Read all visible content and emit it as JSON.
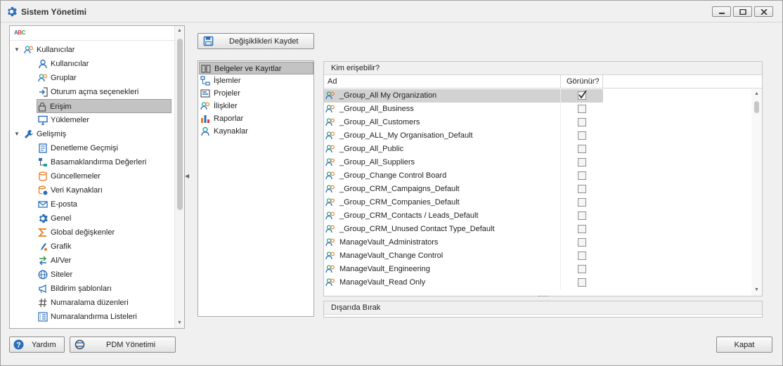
{
  "window": {
    "title": "Sistem Yönetimi"
  },
  "tree": {
    "items": [
      {
        "label": "Kullanıcılar",
        "level": 0,
        "icon": "users-icon",
        "expanded": true
      },
      {
        "label": "Kullanıcılar",
        "level": 1,
        "icon": "user-icon"
      },
      {
        "label": "Gruplar",
        "level": 1,
        "icon": "group-icon"
      },
      {
        "label": "Oturum açma seçenekleri",
        "level": 1,
        "icon": "login-options-icon"
      },
      {
        "label": "Erişim",
        "level": 1,
        "icon": "lock-icon",
        "selected": true
      },
      {
        "label": "Yüklemeler",
        "level": 1,
        "icon": "monitor-icon"
      },
      {
        "label": "Gelişmiş",
        "level": 0,
        "icon": "wrench-icon",
        "expanded": true
      },
      {
        "label": "Denetleme Geçmişi",
        "level": 1,
        "icon": "audit-icon"
      },
      {
        "label": "Basamaklandırma Değerleri",
        "level": 1,
        "icon": "cascade-icon"
      },
      {
        "label": "Güncellemeler",
        "level": 1,
        "icon": "database-icon"
      },
      {
        "label": "Veri Kaynakları",
        "level": 1,
        "icon": "datasource-icon"
      },
      {
        "label": "E-posta",
        "level": 1,
        "icon": "email-icon"
      },
      {
        "label": "Genel",
        "level": 1,
        "icon": "gear-icon"
      },
      {
        "label": "Global değişkenler",
        "level": 1,
        "icon": "sigma-icon"
      },
      {
        "label": "Grafik",
        "level": 1,
        "icon": "paint-icon"
      },
      {
        "label": "Al/Ver",
        "level": 1,
        "icon": "transfer-icon"
      },
      {
        "label": "Siteler",
        "level": 1,
        "icon": "globe-icon"
      },
      {
        "label": "Bildirim şablonları",
        "level": 1,
        "icon": "megaphone-icon"
      },
      {
        "label": "Numaralama düzenleri",
        "level": 1,
        "icon": "hash-icon"
      },
      {
        "label": "Numaralandırma Listeleri",
        "level": 1,
        "icon": "list-icon"
      }
    ]
  },
  "toolbar": {
    "save_label": "Değişiklikleri Kaydet"
  },
  "categories": [
    {
      "label": "Belgeler ve Kayıtlar",
      "icon": "documents-icon",
      "selected": true
    },
    {
      "label": "İşlemler",
      "icon": "process-icon"
    },
    {
      "label": "Projeler",
      "icon": "projects-icon"
    },
    {
      "label": "İlişkiler",
      "icon": "relations-icon"
    },
    {
      "label": "Raporlar",
      "icon": "chart-icon"
    },
    {
      "label": "Kaynaklar",
      "icon": "resources-icon"
    }
  ],
  "access_grid": {
    "caption": "Kim erişebilir?",
    "col_name": "Ad",
    "col_visible": "Görünür?",
    "rows": [
      {
        "name": "_Group_All My Organization",
        "visible": true,
        "active": true
      },
      {
        "name": "_Group_All_Business",
        "visible": false
      },
      {
        "name": "_Group_All_Customers",
        "visible": false
      },
      {
        "name": "_Group_ALL_My Organisation_Default",
        "visible": false
      },
      {
        "name": "_Group_All_Public",
        "visible": false
      },
      {
        "name": "_Group_All_Suppliers",
        "visible": false
      },
      {
        "name": "_Group_Change Control Board",
        "visible": false
      },
      {
        "name": "_Group_CRM_Campaigns_Default",
        "visible": false
      },
      {
        "name": "_Group_CRM_Companies_Default",
        "visible": false
      },
      {
        "name": "_Group_CRM_Contacts / Leads_Default",
        "visible": false
      },
      {
        "name": "_Group_CRM_Unused Contact Type_Default",
        "visible": false
      },
      {
        "name": "ManageVault_Administrators",
        "visible": false
      },
      {
        "name": "ManageVault_Change Control",
        "visible": false
      },
      {
        "name": "ManageVault_Engineering",
        "visible": false
      },
      {
        "name": "ManageVault_Read Only",
        "visible": false
      }
    ]
  },
  "exclude_panel": {
    "caption": "Dışarıda Bırak"
  },
  "footer": {
    "help_label": "Yardım",
    "pdm_label": "PDM Yönetimi",
    "close_label": "Kapat"
  },
  "colors": {
    "accent": "#2a6fb8",
    "selection": "#c3c3c3",
    "teal": "#22a39a",
    "orange": "#e87c1e"
  }
}
